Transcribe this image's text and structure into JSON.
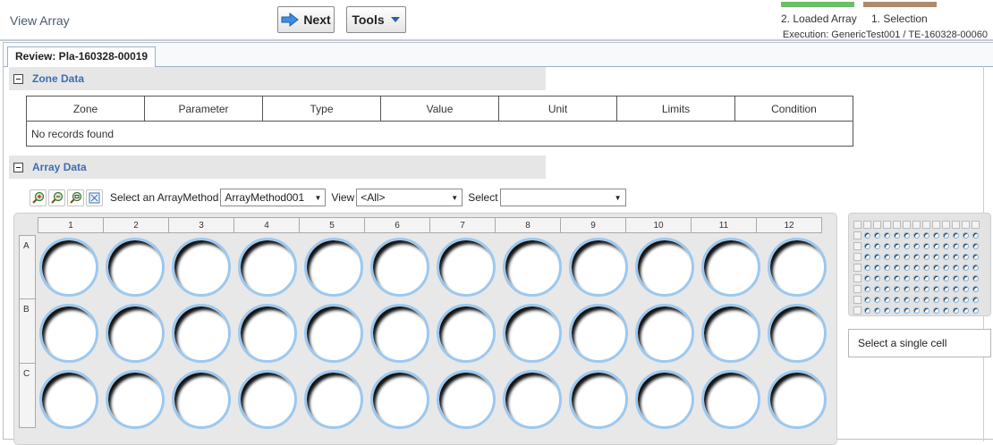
{
  "header": {
    "title": "View Array",
    "next_label": "Next",
    "tools_label": "Tools",
    "steps": [
      {
        "label": "2. Loaded Array",
        "color": "#6cbf68"
      },
      {
        "label": "1. Selection",
        "color": "#b08a6e"
      }
    ],
    "execution": "Execution: GenericTest001 / TE-160328-00060"
  },
  "tab": {
    "label": "Review: Pla-160328-00019"
  },
  "zone_section": {
    "title": "Zone Data",
    "columns": [
      "Zone",
      "Parameter",
      "Type",
      "Value",
      "Unit",
      "Limits",
      "Condition"
    ],
    "empty_text": "No records found"
  },
  "array_section": {
    "title": "Array Data",
    "toolbar_icons": [
      "zoom-in-icon",
      "zoom-out-icon",
      "zoom-reset-icon",
      "fit-icon"
    ],
    "array_method_label": "Select an ArrayMethod",
    "array_method_value": "ArrayMethod001",
    "view_label": "View",
    "view_value": "<All>",
    "select_label": "Select",
    "select_value": ""
  },
  "plate": {
    "columns": [
      "1",
      "2",
      "3",
      "4",
      "5",
      "6",
      "7",
      "8",
      "9",
      "10",
      "11",
      "12"
    ],
    "rows": [
      "A",
      "B",
      "C"
    ],
    "well_border_color": "#9cc8ef"
  },
  "side_panel": {
    "cell_info": "Select a single cell"
  }
}
